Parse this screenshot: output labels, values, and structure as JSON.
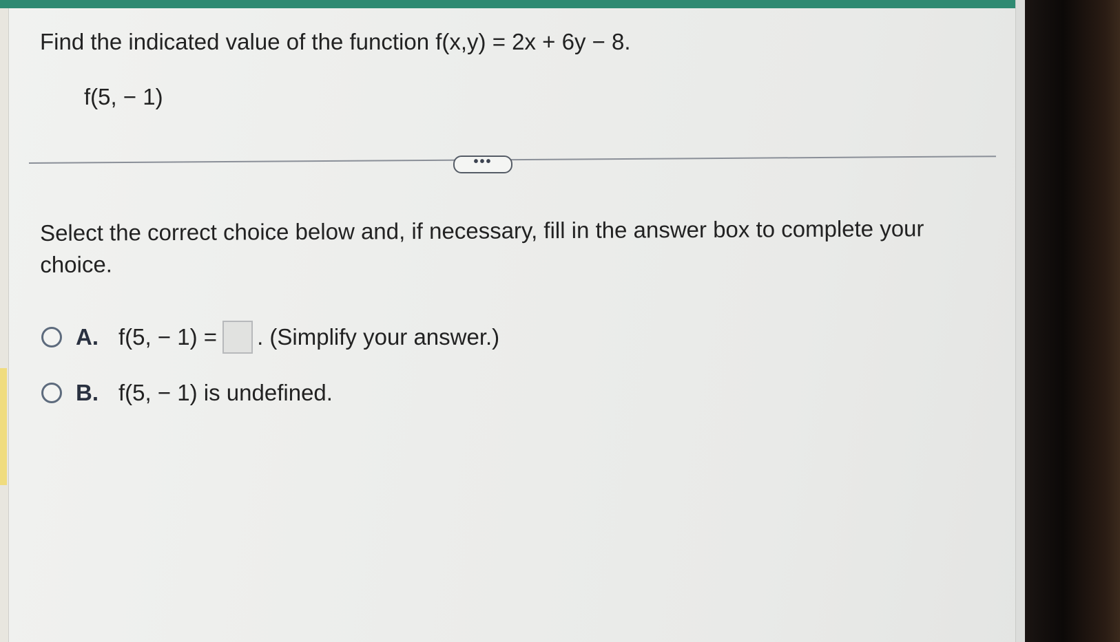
{
  "question": {
    "prompt": "Find the indicated value of the function f(x,y) = 2x + 6y − 8.",
    "expression": "f(5, − 1)"
  },
  "more_button": {
    "label": "•••"
  },
  "instructions": "Select the correct choice below and, if necessary, fill in the answer box to complete your choice.",
  "choices": [
    {
      "letter": "A.",
      "text_before": "f(5, − 1) =",
      "text_after": ". (Simplify your answer.)",
      "answer_value": ""
    },
    {
      "letter": "B.",
      "text": "f(5, − 1) is undefined."
    }
  ],
  "colors": {
    "top_band": "#2f8a72",
    "radio_border": "#5d6b7d",
    "highlight": "#f0dc7e"
  }
}
